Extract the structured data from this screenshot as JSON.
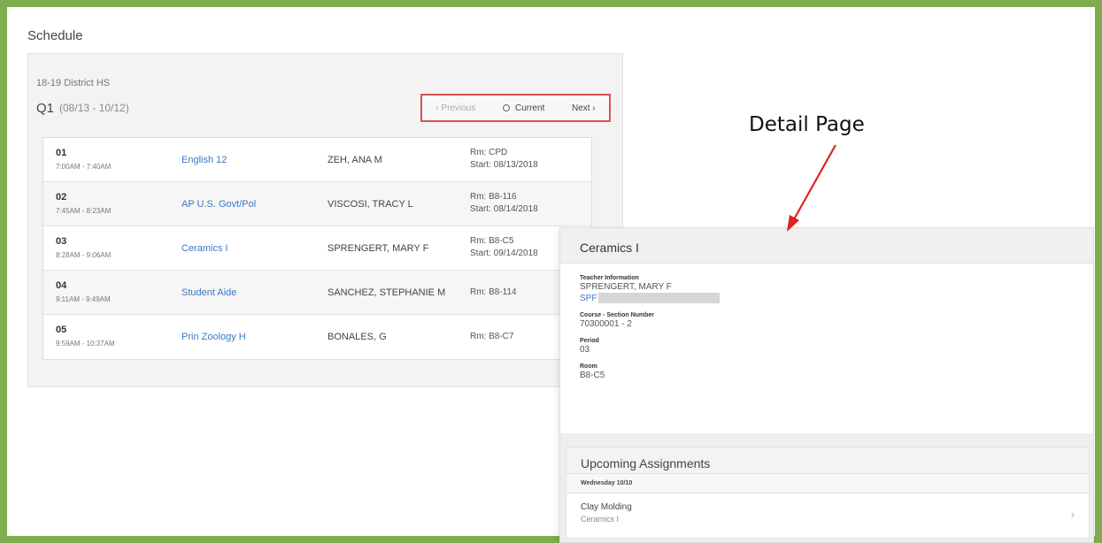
{
  "page": {
    "title": "Schedule"
  },
  "schedule": {
    "district": "18-19 District HS",
    "term": "Q1",
    "term_dates": "(08/13 - 10/12)",
    "nav": {
      "previous": "‹ Previous",
      "current": "Current",
      "next": "Next ›"
    },
    "rows": [
      {
        "period": "01",
        "time": "7:00AM - 7:40AM",
        "course": "English 12",
        "teacher": "ZEH, ANA M",
        "room": "Rm: CPD",
        "start": "Start: 08/13/2018"
      },
      {
        "period": "02",
        "time": "7:45AM - 8:23AM",
        "course": "AP U.S. Govt/Pol",
        "teacher": "VISCOSI, TRACY L",
        "room": "Rm: B8-116",
        "start": "Start: 08/14/2018"
      },
      {
        "period": "03",
        "time": "8:28AM - 9:06AM",
        "course": "Ceramics I",
        "teacher": "SPRENGERT, MARY F",
        "room": "Rm: B8-C5",
        "start": "Start: 09/14/2018"
      },
      {
        "period": "04",
        "time": "9:11AM - 9:49AM",
        "course": "Student Aide",
        "teacher": "SANCHEZ, STEPHANIE M",
        "room": "Rm: B8-114",
        "start": ""
      },
      {
        "period": "05",
        "time": "9:59AM - 10:37AM",
        "course": "Prin Zoology H",
        "teacher": "BONALES, G",
        "room": "Rm: B8-C7",
        "start": ""
      }
    ]
  },
  "annotation": {
    "label": "Detail Page"
  },
  "detail": {
    "title": "Ceramics I",
    "teacher_label": "Teacher Information",
    "teacher_name": "SPRENGERT, MARY F",
    "teacher_email": "SPF",
    "section_label": "Course - Section Number",
    "section_value": "70300001 - 2",
    "period_label": "Period",
    "period_value": "03",
    "room_label": "Room",
    "room_value": "B8-C5"
  },
  "assignments": {
    "title": "Upcoming Assignments",
    "day": "Wednesday 10/10",
    "items": [
      {
        "name": "Clay Molding",
        "course": "Ceramics I"
      }
    ]
  },
  "colors": {
    "frame": "#7fac4e",
    "link": "#3a78c2",
    "highlight": "#d9534f",
    "arrow": "#e02020"
  }
}
